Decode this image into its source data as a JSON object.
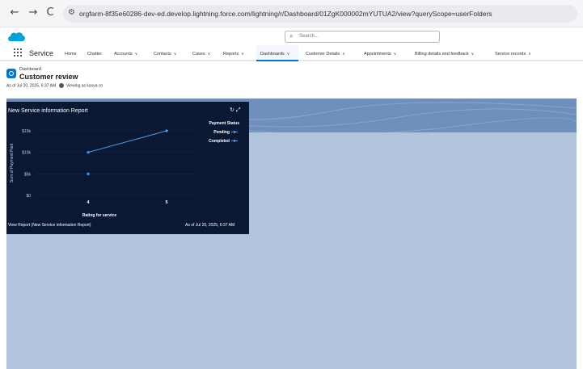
{
  "browser": {
    "back": "←",
    "forward": "→",
    "reload": "C",
    "url": "orgfarm-8f35e60286-dev-ed.develop.lightning.force.com/lightning/r/Dashboard/01ZgK000002mYUTUA2/view?queryScope=userFolders"
  },
  "header": {
    "search_placeholder": "Search..."
  },
  "nav": {
    "app_name": "Service",
    "items": [
      {
        "label": "Home",
        "has_menu": false
      },
      {
        "label": "Chatter",
        "has_menu": false
      },
      {
        "label": "Accounts",
        "has_menu": true
      },
      {
        "label": "Contacts",
        "has_menu": true
      },
      {
        "label": "Cases",
        "has_menu": true
      },
      {
        "label": "Reports",
        "has_menu": true
      },
      {
        "label": "Dashboards",
        "has_menu": true
      },
      {
        "label": "Customer Details",
        "has_menu": true
      },
      {
        "label": "Appointments",
        "has_menu": true
      },
      {
        "label": "Billing details and feedback",
        "has_menu": true
      },
      {
        "label": "Service records",
        "has_menu": true
      }
    ],
    "active": "Dashboards"
  },
  "page": {
    "object_label": "Dashboard",
    "title": "Customer review",
    "as_of": "As of Jul 20, 2025, 6:37 AM",
    "viewing_as": "Viewing as kavya cn"
  },
  "widget": {
    "title": "New Service information Report",
    "footer_link": "View Report (New Service information Report)",
    "footer_asof": "As of Jul 20, 2025, 6:37 AM"
  },
  "chart_data": {
    "type": "line",
    "title": "",
    "xlabel": "Rating for service",
    "ylabel": "Sum of Payment Paid",
    "x": [
      4,
      5
    ],
    "yticks": [
      "$0",
      "$5k",
      "$10k",
      "$15k"
    ],
    "ylim": [
      0,
      15000
    ],
    "legend_title": "Payment Status",
    "legend_position": "top-right",
    "series": [
      {
        "name": "Pending",
        "points": [
          [
            4,
            10000
          ],
          [
            5,
            15000
          ]
        ],
        "color": "#4a9fe8"
      },
      {
        "name": "Completed",
        "points": [
          [
            4,
            5000
          ]
        ],
        "color": "#4a9fe8"
      }
    ]
  },
  "colors": {
    "accent": "#0176d3",
    "widget_bg": "#0b1833",
    "canvas_bg": "#b0c4de"
  }
}
